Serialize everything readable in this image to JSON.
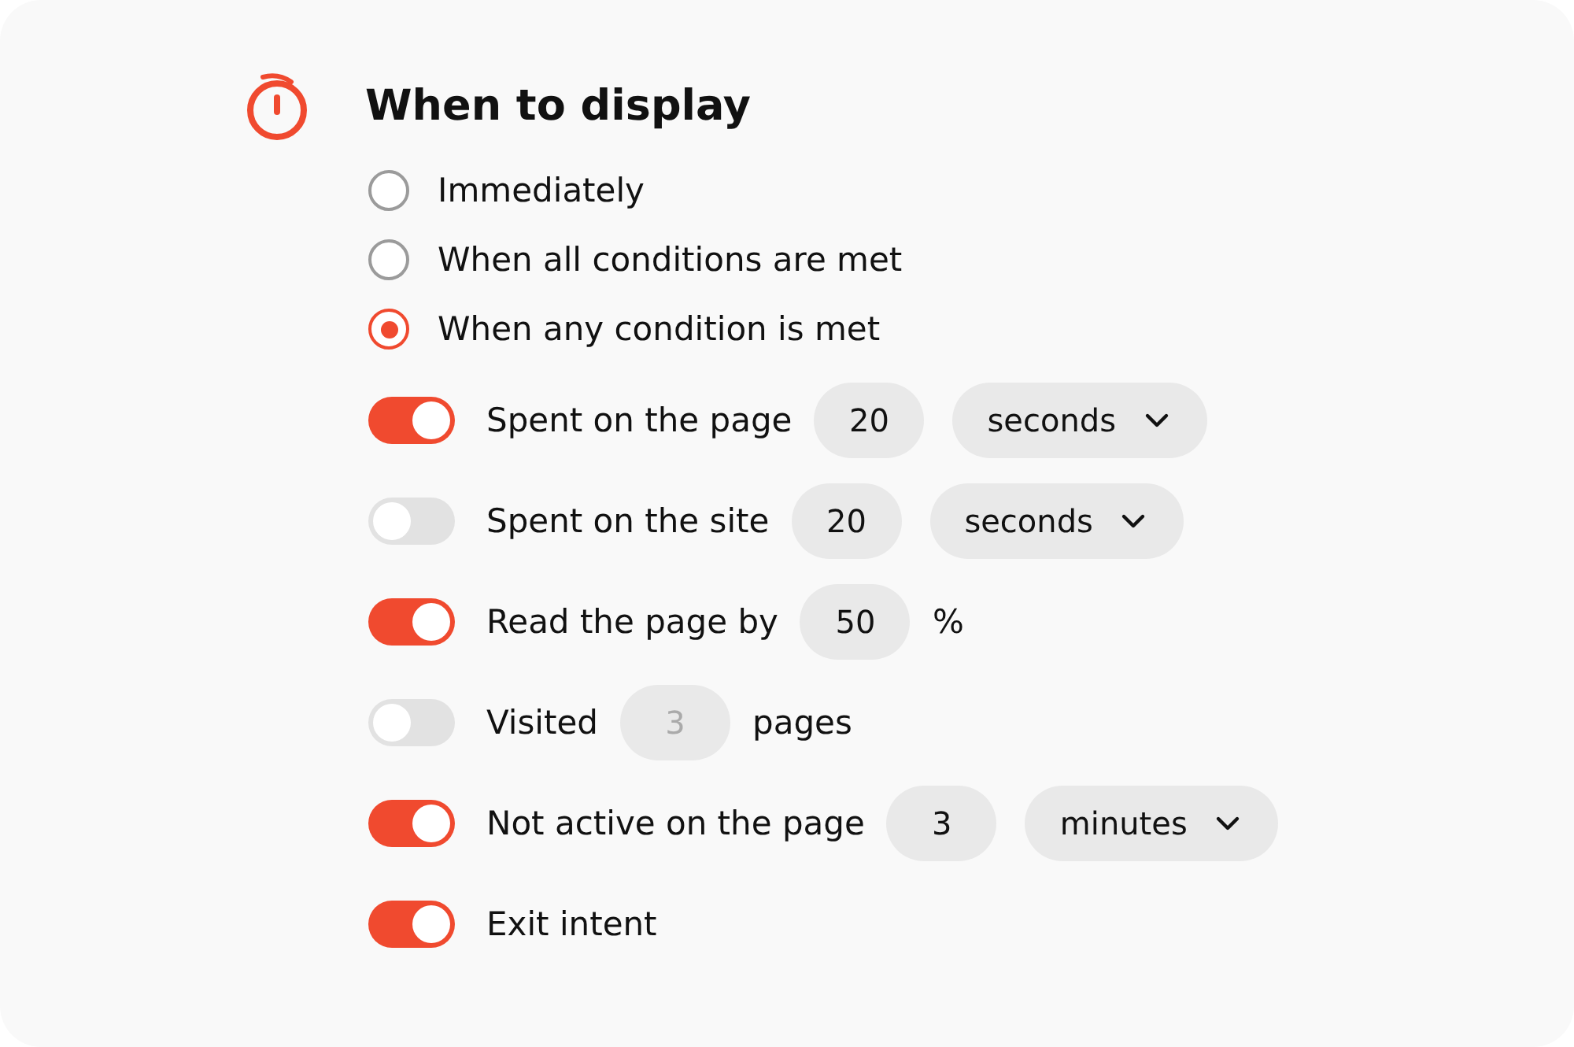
{
  "section": {
    "title": "When to display"
  },
  "display_options": [
    {
      "label": "Immediately",
      "selected": false
    },
    {
      "label": "When all conditions are met",
      "selected": false
    },
    {
      "label": "When any condition is met",
      "selected": true
    }
  ],
  "conditions": [
    {
      "on": true,
      "label": "Spent on the page",
      "value": {
        "text": "20",
        "disabled": false
      },
      "unit": {
        "kind": "dropdown",
        "text": "seconds"
      }
    },
    {
      "on": false,
      "label": "Spent on the site",
      "value": {
        "text": "20",
        "disabled": false
      },
      "unit": {
        "kind": "dropdown",
        "text": "seconds"
      }
    },
    {
      "on": true,
      "label": "Read the page by",
      "value": {
        "text": "50",
        "disabled": false
      },
      "unit": {
        "kind": "text",
        "text": "%"
      }
    },
    {
      "on": false,
      "label": "Visited",
      "value": {
        "text": "3",
        "disabled": true
      },
      "unit": {
        "kind": "text",
        "text": "pages"
      }
    },
    {
      "on": true,
      "label": "Not active on the page",
      "value": {
        "text": "3",
        "disabled": false
      },
      "unit": {
        "kind": "dropdown",
        "text": "minutes"
      }
    },
    {
      "on": true,
      "label": "Exit intent"
    }
  ]
}
